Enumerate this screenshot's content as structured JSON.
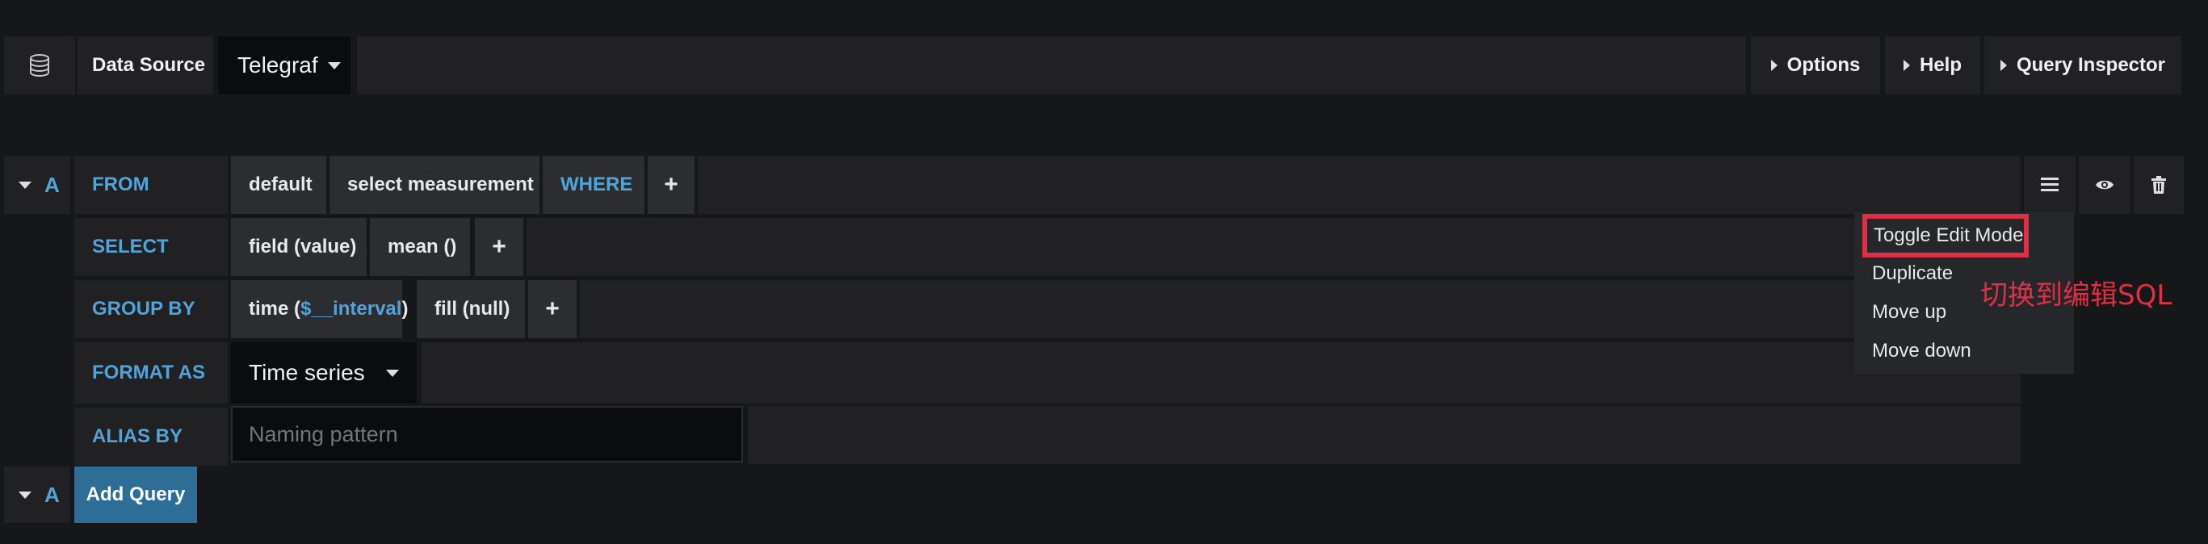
{
  "datasource": {
    "label": "Data Source",
    "value": "Telegraf",
    "icon": "database-icon"
  },
  "toolbar": {
    "options": "Options",
    "help": "Help",
    "inspector": "Query Inspector"
  },
  "query": {
    "ref_id": "A",
    "from": {
      "keyword": "FROM",
      "policy": "default",
      "measurement": "select measurement",
      "where": "WHERE"
    },
    "select": {
      "keyword": "SELECT",
      "field": "field (value)",
      "agg": "mean ()"
    },
    "group_by": {
      "keyword": "GROUP BY",
      "time_prefix": "time (",
      "time_var": "$__interval",
      "time_suffix": ")",
      "fill": "fill (null)"
    },
    "format_as": {
      "keyword": "FORMAT AS",
      "value": "Time series"
    },
    "alias_by": {
      "keyword": "ALIAS BY",
      "placeholder": "Naming pattern"
    }
  },
  "menu": {
    "items": [
      "Toggle Edit Mode",
      "Duplicate",
      "Move up",
      "Move down"
    ]
  },
  "annotation": "切换到编辑SQL",
  "add_query": {
    "ref_id": "A",
    "label": "Add Query"
  },
  "colors": {
    "keyword": "#52a3d8",
    "highlight": "#e02f44",
    "add_btn": "#2e6d96",
    "background": "#161719"
  }
}
